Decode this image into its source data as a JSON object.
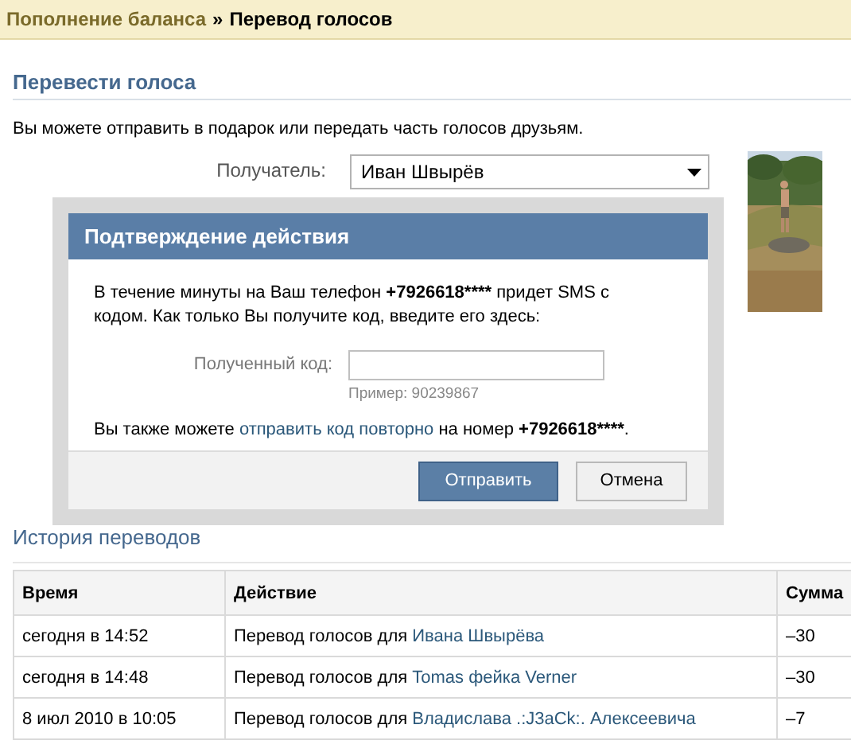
{
  "breadcrumb": [
    {
      "label": "Пополнение баланса",
      "kind": "link"
    },
    {
      "label": "»",
      "kind": "separator"
    },
    {
      "label": "Перевод голосов",
      "kind": "current"
    }
  ],
  "section_title": "Перевести голоса",
  "description": "Вы можете отправить в подарок или передать часть голосов друзьям.",
  "recipient": {
    "label": "Получатель:",
    "value": "Иван Швырёв"
  },
  "dialog": {
    "title": "Подтверждение действия",
    "message_before": "В течение минуты на Ваш телефон ",
    "phone": "+7926618****",
    "message_after": " придет SMS с кодом. Как только Вы получите код, введите его здесь:",
    "code_label": "Полученный код:",
    "code_hint": "Пример: 90239867",
    "resend_before": "Вы также можете ",
    "resend_link": "отправить код повторно",
    "resend_middle": " на номер ",
    "resend_phone": "+7926618****",
    "resend_after": ".",
    "buttons": [
      {
        "label": "Отправить",
        "kind": "primary"
      },
      {
        "label": "Отмена",
        "kind": "secondary"
      }
    ]
  },
  "history_title": "История переводов",
  "table": {
    "columns": [
      "Время",
      "Действие",
      "Сумма"
    ],
    "rows": [
      {
        "time": "сегодня в 14:52",
        "action_text": "Перевод голосов для ",
        "action_link": "Ивана Швырёва",
        "amount": "–30"
      },
      {
        "time": "сегодня в 14:48",
        "action_text": "Перевод голосов для ",
        "action_link": "Tomas фейка Verner",
        "amount": "–30"
      },
      {
        "time": "8 июл 2010 в 10:05",
        "action_text": "Перевод голосов для ",
        "action_link": "Владислава .:J3aCk:. Алексеевича",
        "amount": "–7"
      }
    ]
  }
}
